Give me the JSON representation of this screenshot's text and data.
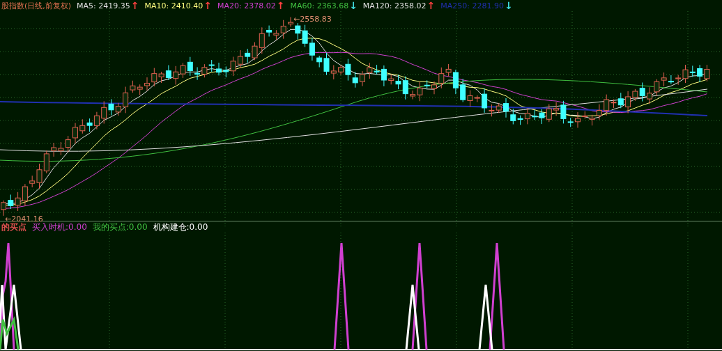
{
  "main_legend": {
    "title": "股指数(日线,前复权)",
    "items": [
      {
        "label": "MA5:",
        "value": "2419.35",
        "color": "#e0e0e0",
        "arrow": {
          "text": "↑",
          "color": "#ff4040"
        }
      },
      {
        "label": "MA10:",
        "value": "2410.40",
        "color": "#ffff80",
        "arrow": {
          "text": "↑",
          "color": "#ff4040"
        }
      },
      {
        "label": "MA20:",
        "value": "2378.02",
        "color": "#d040d0",
        "arrow": {
          "text": "↑",
          "color": "#ff4040"
        }
      },
      {
        "label": "MA60:",
        "value": "2363.68",
        "color": "#40c040",
        "arrow": {
          "text": "↓",
          "color": "#40e0e0"
        }
      },
      {
        "label": "MA120:",
        "value": "2358.02",
        "color": "#e0e0e0",
        "arrow": {
          "text": "↑",
          "color": "#ff4040"
        }
      },
      {
        "label": "MA250:",
        "value": "2281.90",
        "color": "#2030b0",
        "arrow": {
          "text": "↓",
          "color": "#40e0e0"
        }
      }
    ]
  },
  "price_marks": {
    "high": "←2558.83",
    "low": "←2041.16"
  },
  "indicator_legend": {
    "items": [
      {
        "label": "的买点",
        "color": "#e05050"
      },
      {
        "label": "买入时机:",
        "value": "0.00",
        "color": "#d040d0"
      },
      {
        "label": "我的买点:",
        "value": "0.00",
        "color": "#40c040"
      },
      {
        "label": "机构建仓:",
        "value": "0.00",
        "color": "#ffffff"
      }
    ]
  }
}
